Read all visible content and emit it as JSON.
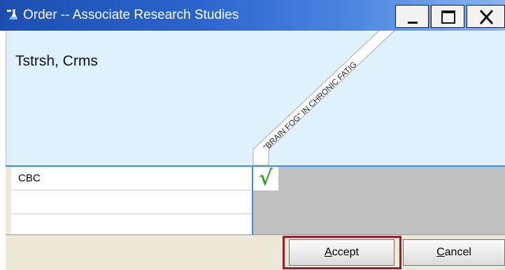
{
  "window": {
    "title": "Order -- Associate Research Studies"
  },
  "patient": {
    "name": "Tstrsh, Crms"
  },
  "column_header": {
    "label": "\"BRAIN FOG\" IN CHRONIC FATIG"
  },
  "rows": [
    {
      "label": "CBC",
      "checked": true
    },
    {
      "label": "",
      "checked": false
    }
  ],
  "buttons": {
    "accept": {
      "label": "Accept",
      "accel": "A",
      "rest": "ccept"
    },
    "cancel": {
      "label": "Cancel",
      "accel": "C",
      "rest": "ancel"
    }
  },
  "check_symbol": "√",
  "colors": {
    "title_bar": "#2c65cf",
    "grid_line": "#3a8fd8",
    "highlight": "#9b1e2c",
    "check": "#3aa030"
  }
}
